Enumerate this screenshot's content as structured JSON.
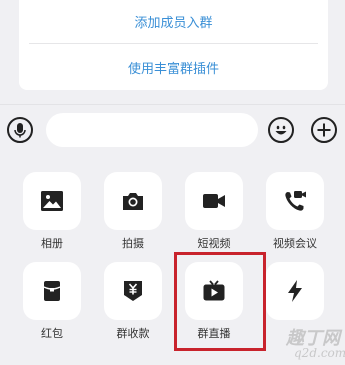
{
  "menu": {
    "add_member": "添加成员入群",
    "rich_plugin": "使用丰富群插件"
  },
  "input_bar": {
    "placeholder": "",
    "icons": [
      "microphone-icon",
      "emoji-icon",
      "plus-icon"
    ]
  },
  "apps": [
    {
      "label": "相册",
      "icon": "image-icon"
    },
    {
      "label": "拍摄",
      "icon": "camera-icon"
    },
    {
      "label": "短视频",
      "icon": "video-camera-icon"
    },
    {
      "label": "视频会议",
      "icon": "video-call-icon"
    },
    {
      "label": "红包",
      "icon": "red-packet-icon"
    },
    {
      "label": "群收款",
      "icon": "yuan-collect-icon"
    },
    {
      "label": "群直播",
      "icon": "live-tv-icon"
    },
    {
      "label": "",
      "icon": "lightning-icon"
    }
  ],
  "colors": {
    "link": "#3a8fd6",
    "highlight": "#c8232c",
    "icon": "#222222",
    "background": "#f0f0f3"
  },
  "watermark": {
    "text_cn": "趣丁网",
    "text_en": "q2d.com"
  }
}
